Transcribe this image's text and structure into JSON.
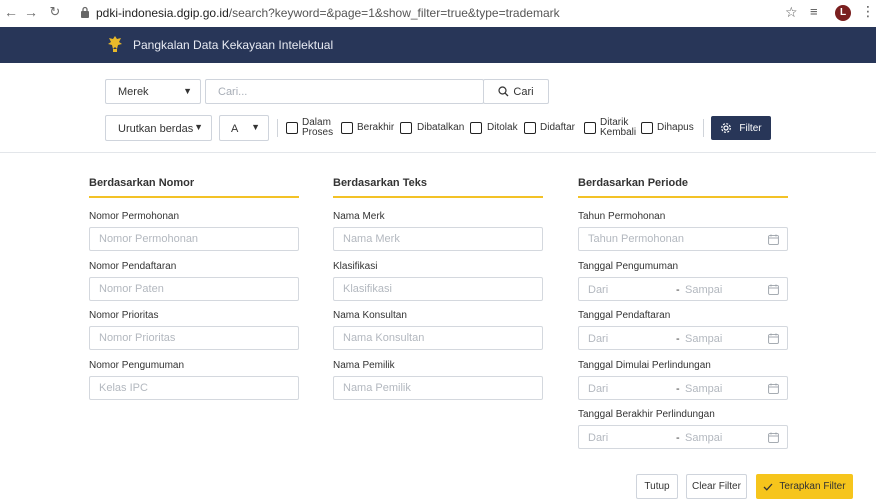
{
  "browser": {
    "url_host": "pdki-indonesia.dgip.go.id",
    "url_path": "/search?keyword=&page=1&show_filter=true&type=trademark",
    "profile_initial": "L"
  },
  "app": {
    "title": "Pangkalan Data Kekayaan Intelektual"
  },
  "search": {
    "category": "Merek",
    "placeholder": "Cari...",
    "button_label": "Cari"
  },
  "filters": {
    "sort_label": "Urutkan berdas",
    "order_label": "A",
    "statuses": [
      {
        "line1": "Dalam",
        "line2": "Proses"
      },
      {
        "line1": "Berakhir",
        "line2": ""
      },
      {
        "line1": "Dibatalkan",
        "line2": ""
      },
      {
        "line1": "Ditolak",
        "line2": ""
      },
      {
        "line1": "Didaftar",
        "line2": ""
      },
      {
        "line1": "Ditarik",
        "line2": "Kembali"
      },
      {
        "line1": "Dihapus",
        "line2": ""
      }
    ],
    "filter_button": "Filter"
  },
  "columns": {
    "nomor": {
      "title": "Berdasarkan Nomor",
      "fields": [
        {
          "label": "Nomor Permohonan",
          "placeholder": "Nomor Permohonan"
        },
        {
          "label": "Nomor Pendaftaran",
          "placeholder": "Nomor Paten"
        },
        {
          "label": "Nomor Prioritas",
          "placeholder": "Nomor Prioritas"
        },
        {
          "label": "Nomor Pengumuman",
          "placeholder": "Kelas IPC"
        }
      ]
    },
    "teks": {
      "title": "Berdasarkan Teks",
      "fields": [
        {
          "label": "Nama Merk",
          "placeholder": "Nama Merk"
        },
        {
          "label": "Klasifikasi",
          "placeholder": "Klasifikasi"
        },
        {
          "label": "Nama Konsultan",
          "placeholder": "Nama Konsultan"
        },
        {
          "label": "Nama Pemilik",
          "placeholder": "Nama Pemilik"
        }
      ]
    },
    "periode": {
      "title": "Berdasarkan Periode",
      "year_field": {
        "label": "Tahun Permohonan",
        "placeholder": "Tahun Permohonan"
      },
      "ranges": [
        {
          "label": "Tanggal Pengumuman",
          "from": "Dari",
          "dash": "-",
          "to": "Sampai"
        },
        {
          "label": "Tanggal Pendaftaran",
          "from": "Dari",
          "dash": "-",
          "to": "Sampai"
        },
        {
          "label": "Tanggal Dimulai Perlindungan",
          "from": "Dari",
          "dash": "-",
          "to": "Sampai"
        },
        {
          "label": "Tanggal Berakhir Perlindungan",
          "from": "Dari",
          "dash": "-",
          "to": "Sampai"
        }
      ]
    }
  },
  "footer": {
    "close_label": "Tutup",
    "clear_label": "Clear Filter",
    "apply_label": "Terapkan Filter"
  },
  "colors": {
    "header_navy": "#283658",
    "accent_yellow": "#f6c51c"
  }
}
